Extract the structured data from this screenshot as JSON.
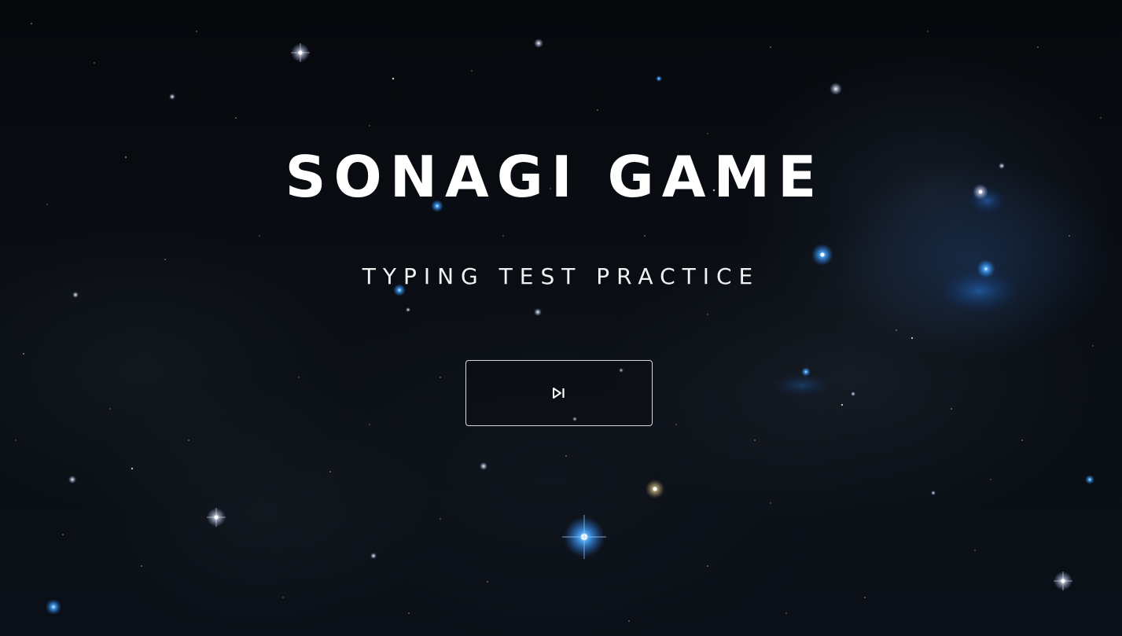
{
  "game": {
    "title": "SONAGI GAME",
    "subtitle": "TYPING TEST PRACTICE"
  },
  "start_button": {
    "icon": "play-next-icon"
  },
  "theme": {
    "background": "#05070b",
    "text": "#ffffff",
    "button_border": "#d8d8d8",
    "star_blue": "#3aa0ff"
  }
}
